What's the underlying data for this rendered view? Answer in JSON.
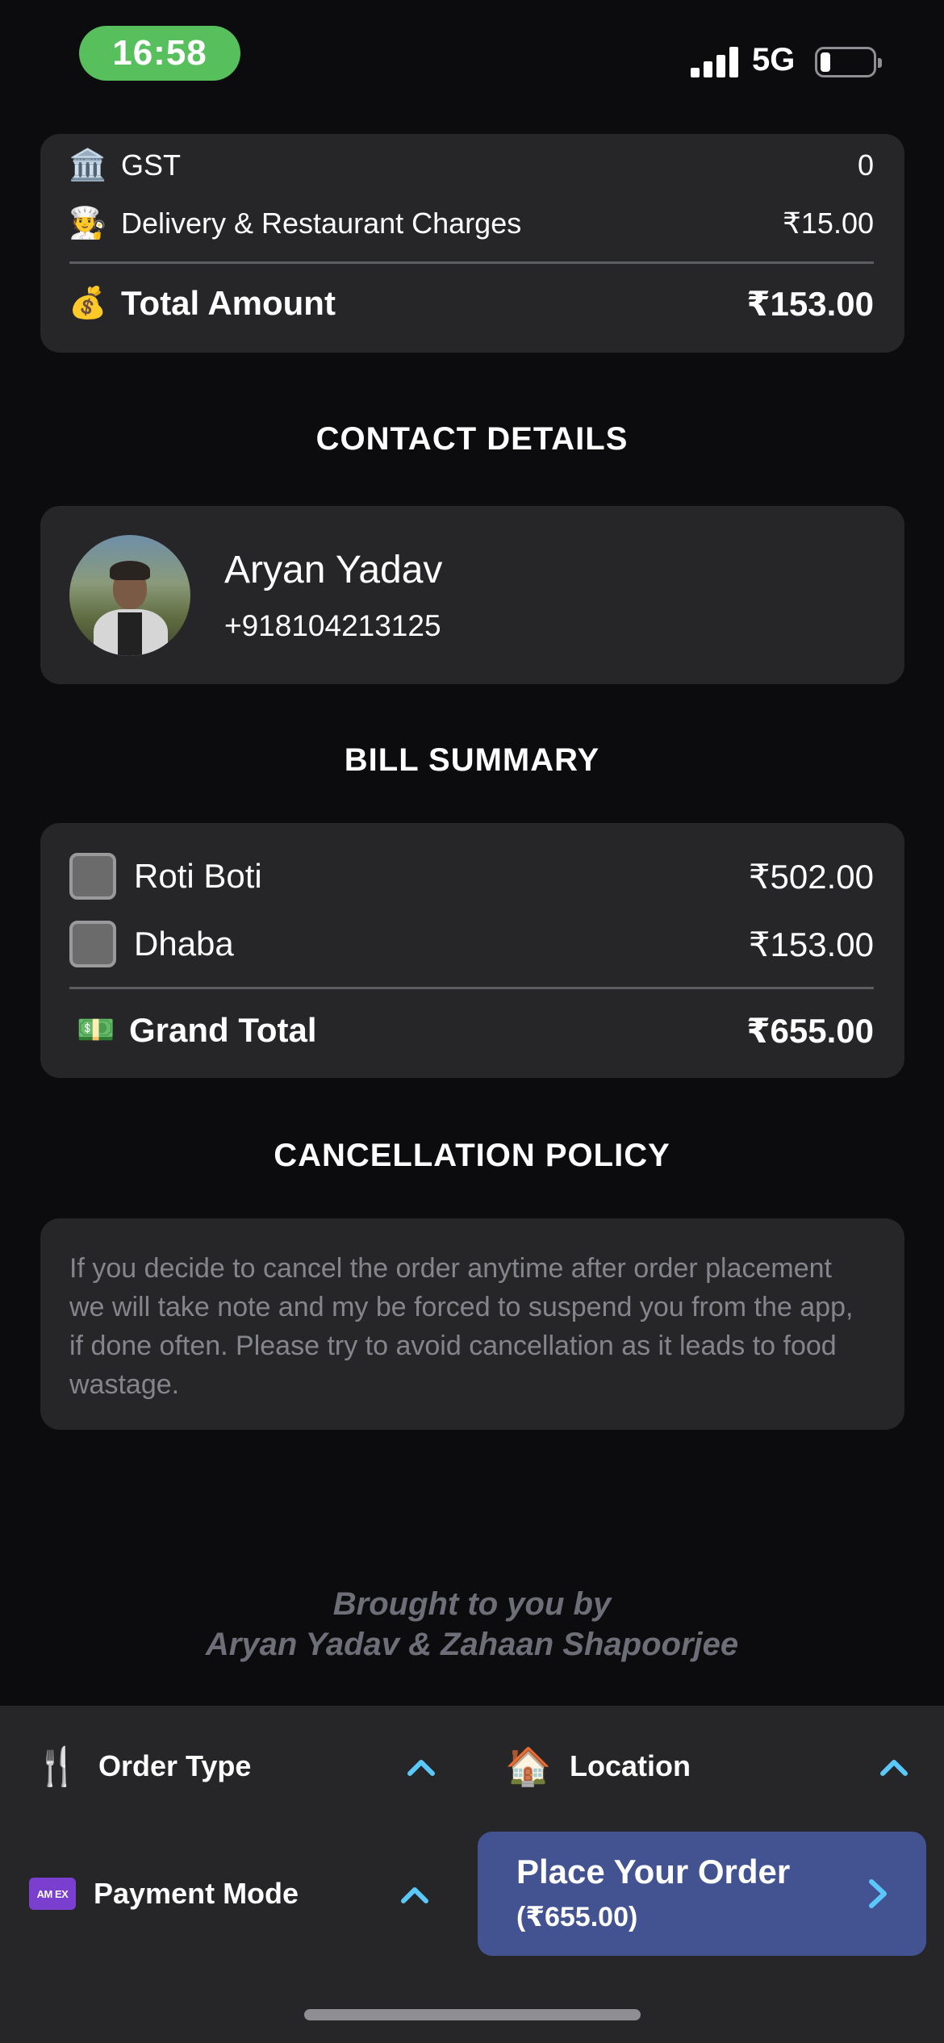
{
  "status_bar": {
    "time": "16:58",
    "network": "5G",
    "battery_percent": 15
  },
  "summary_card": {
    "rows": [
      {
        "icon": "bank-icon",
        "emoji": "🏛️",
        "label": "GST",
        "value": "0"
      },
      {
        "icon": "delivery-person-icon",
        "emoji": "🧑‍🍳",
        "label": "Delivery & Restaurant Charges",
        "value": "₹15.00"
      }
    ],
    "total": {
      "icon": "money-bag-icon",
      "emoji": "💰",
      "label": "Total Amount",
      "value": "₹153.00"
    }
  },
  "contact": {
    "title": "CONTACT DETAILS",
    "name": "Aryan Yadav",
    "phone": "+918104213125"
  },
  "bill": {
    "title": "BILL SUMMARY",
    "items": [
      {
        "name": "Roti Boti",
        "amount": "₹502.00"
      },
      {
        "name": "Dhaba",
        "amount": "₹153.00"
      }
    ],
    "grand_total": {
      "icon": "banknote-icon",
      "emoji": "💵",
      "label": "Grand Total",
      "value": "₹655.00"
    }
  },
  "policy": {
    "title": "CANCELLATION POLICY",
    "text": "If you decide to cancel the order anytime after order placement we will take note and my be forced to suspend you from the app, if done often. Please try to avoid cancellation as it leads to food wastage."
  },
  "credits": {
    "line1": "Brought to you by",
    "line2": "Aryan Yadav & Zahaan Shapoorjee"
  },
  "bottom": {
    "order_type": {
      "label": "Order Type",
      "icon": "restaurant-icon",
      "emoji": "🍴"
    },
    "location": {
      "label": "Location",
      "icon": "house-icon",
      "emoji": "🏠"
    },
    "payment_mode": {
      "label": "Payment Mode",
      "icon": "amex-card-icon",
      "card_text": "AM EX"
    },
    "place_order": {
      "label": "Place Your Order",
      "amount": "(₹655.00)"
    }
  },
  "colors": {
    "background": "#0c0c0e",
    "card": "#262628",
    "accent_chevron": "#5ac8fa",
    "order_button": "#435391",
    "time_pill": "#57c05c"
  }
}
